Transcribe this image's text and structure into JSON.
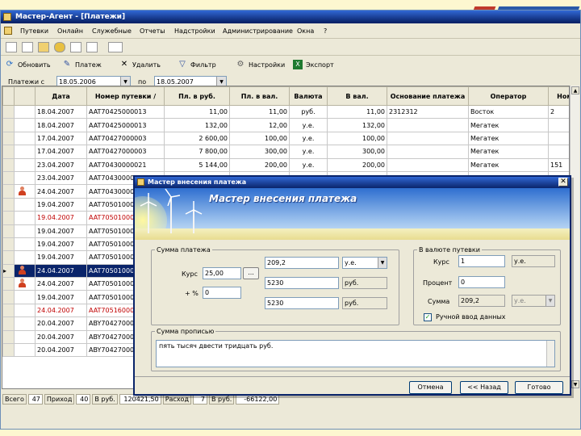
{
  "window": {
    "title": "Мастер-Агент - [Платежи]"
  },
  "menu": [
    "Путевки",
    "Онлайн",
    "Служебные",
    "Отчеты",
    "Надстройки",
    "Администрирование",
    "Окна",
    "?"
  ],
  "toolbar": {
    "refresh": "Обновить",
    "payment": "Платеж",
    "delete": "Удалить",
    "filter": "Фильтр",
    "settings": "Настройки",
    "export": "Экспорт"
  },
  "filter": {
    "label_from": "Платежи с",
    "date_from": "18.05.2006",
    "label_to": "по",
    "date_to": "18.05.2007"
  },
  "grid": {
    "headers": [
      "Дата",
      "Номер путевки",
      "Пл. в руб.",
      "Пл. в вал.",
      "Валюта",
      "В вал.",
      "Основание платежа",
      "Оператор",
      "Ном"
    ],
    "rows": [
      {
        "date": "18.04.2007",
        "voucher": "AAT70425000013",
        "rub": "11,00",
        "cur_pay": "11,00",
        "currency": "руб.",
        "in_cur": "11,00",
        "basis": "2312312",
        "operator": "Восток",
        "num": "2",
        "style": "",
        "icon": false
      },
      {
        "date": "18.04.2007",
        "voucher": "AAT70425000013",
        "rub": "132,00",
        "cur_pay": "12,00",
        "currency": "у.е.",
        "in_cur": "132,00",
        "basis": "",
        "operator": "Мегатек",
        "num": "",
        "style": "",
        "icon": false
      },
      {
        "date": "17.04.2007",
        "voucher": "AAT70427000003",
        "rub": "2 600,00",
        "cur_pay": "100,00",
        "currency": "у.е.",
        "in_cur": "100,00",
        "basis": "",
        "operator": "Мегатек",
        "num": "",
        "style": "",
        "icon": false
      },
      {
        "date": "17.04.2007",
        "voucher": "AAT70427000003",
        "rub": "7 800,00",
        "cur_pay": "300,00",
        "currency": "у.е.",
        "in_cur": "300,00",
        "basis": "",
        "operator": "Мегатек",
        "num": "",
        "style": "",
        "icon": false
      },
      {
        "date": "23.04.2007",
        "voucher": "AAT70430000021",
        "rub": "5 144,00",
        "cur_pay": "200,00",
        "currency": "у.е.",
        "in_cur": "200,00",
        "basis": "",
        "operator": "Мегатек",
        "num": "151",
        "style": "",
        "icon": false
      },
      {
        "date": "23.04.2007",
        "voucher": "AAT70430000",
        "rub": "",
        "cur_pay": "",
        "currency": "",
        "in_cur": "",
        "basis": "",
        "operator": "",
        "num": "",
        "style": "",
        "icon": false
      },
      {
        "date": "24.04.2007",
        "voucher": "AAT70430000",
        "rub": "",
        "cur_pay": "",
        "currency": "",
        "in_cur": "",
        "basis": "",
        "operator": "",
        "num": "",
        "style": "",
        "icon": true
      },
      {
        "date": "19.04.2007",
        "voucher": "AAT70501000",
        "rub": "",
        "cur_pay": "",
        "currency": "",
        "in_cur": "",
        "basis": "",
        "operator": "",
        "num": "",
        "style": "",
        "icon": false
      },
      {
        "date": "19.04.2007",
        "voucher": "AAT70501000",
        "rub": "",
        "cur_pay": "",
        "currency": "",
        "in_cur": "",
        "basis": "",
        "operator": "",
        "num": "",
        "style": "red",
        "icon": false
      },
      {
        "date": "19.04.2007",
        "voucher": "AAT70501000",
        "rub": "",
        "cur_pay": "",
        "currency": "",
        "in_cur": "",
        "basis": "",
        "operator": "",
        "num": "",
        "style": "",
        "icon": false
      },
      {
        "date": "19.04.2007",
        "voucher": "AAT70501000",
        "rub": "",
        "cur_pay": "",
        "currency": "",
        "in_cur": "",
        "basis": "",
        "operator": "",
        "num": "",
        "style": "",
        "icon": false
      },
      {
        "date": "19.04.2007",
        "voucher": "AAT70501000",
        "rub": "",
        "cur_pay": "",
        "currency": "",
        "in_cur": "",
        "basis": "",
        "operator": "",
        "num": "",
        "style": "",
        "icon": false
      },
      {
        "date": "24.04.2007",
        "voucher": "AAT70501000",
        "rub": "",
        "cur_pay": "",
        "currency": "",
        "in_cur": "",
        "basis": "",
        "operator": "",
        "num": "",
        "style": "sel",
        "icon": true
      },
      {
        "date": "24.04.2007",
        "voucher": "AAT70501000",
        "rub": "",
        "cur_pay": "",
        "currency": "",
        "in_cur": "",
        "basis": "",
        "operator": "",
        "num": "",
        "style": "",
        "icon": true
      },
      {
        "date": "19.04.2007",
        "voucher": "AAT70501000",
        "rub": "",
        "cur_pay": "",
        "currency": "",
        "in_cur": "",
        "basis": "",
        "operator": "",
        "num": "",
        "style": "",
        "icon": false
      },
      {
        "date": "24.04.2007",
        "voucher": "AAT70516000",
        "rub": "",
        "cur_pay": "",
        "currency": "",
        "in_cur": "",
        "basis": "",
        "operator": "",
        "num": "",
        "style": "red",
        "icon": false
      },
      {
        "date": "20.04.2007",
        "voucher": "ABY70427000",
        "rub": "",
        "cur_pay": "",
        "currency": "",
        "in_cur": "",
        "basis": "",
        "operator": "",
        "num": "",
        "style": "",
        "icon": false
      },
      {
        "date": "20.04.2007",
        "voucher": "ABY70427000",
        "rub": "",
        "cur_pay": "",
        "currency": "",
        "in_cur": "",
        "basis": "",
        "operator": "",
        "num": "",
        "style": "",
        "icon": false
      },
      {
        "date": "20.04.2007",
        "voucher": "ABY70427000",
        "rub": "",
        "cur_pay": "",
        "currency": "",
        "in_cur": "",
        "basis": "",
        "operator": "",
        "num": "",
        "style": "",
        "icon": false
      }
    ]
  },
  "status": [
    {
      "label": "Всего",
      "value": "47"
    },
    {
      "label": "Приход",
      "value": "40"
    },
    {
      "label": "В руб.",
      "value": "120421,50"
    },
    {
      "label": "Расход",
      "value": "7"
    },
    {
      "label": "В руб.",
      "value": "-66122,00"
    }
  ],
  "dialog": {
    "title": "Мастер внесения платежа",
    "banner_title": "Мастер внесения платежа",
    "sum_group": "Сумма платежа",
    "rate_label": "Курс",
    "rate_value": "25,00",
    "ellipsis": "...",
    "percent_label": "+ %",
    "percent_value": "0",
    "amount1": "209,2",
    "currency1": "у.е.",
    "amount2": "5230",
    "currency2": "руб.",
    "amount3": "5230",
    "currency3": "руб.",
    "voucher_group": "В валюте путевки",
    "v_rate_label": "Курс",
    "v_rate_value": "1",
    "v_rate_cur": "у.е.",
    "v_percent_label": "Процент",
    "v_percent_value": "0",
    "v_sum_label": "Сумма",
    "v_sum_value": "209,2",
    "v_sum_cur": "у.е.",
    "manual_label": "Ручной ввод данных",
    "manual_checked": "✓",
    "words_group": "Сумма прописью",
    "words_value": "пять тысяч двести тридцать руб.",
    "cancel": "Отмена",
    "back": "<< Назад",
    "done": "Готово"
  }
}
